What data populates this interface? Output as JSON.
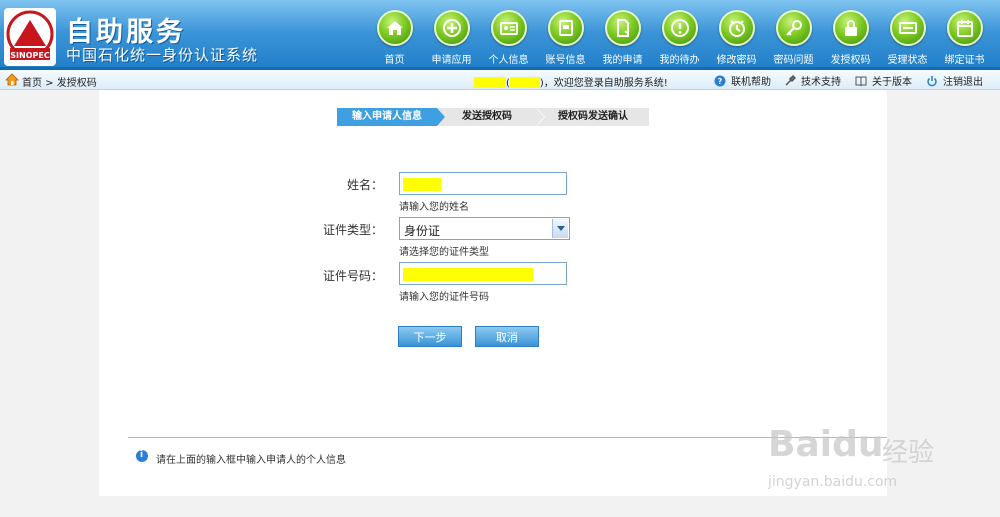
{
  "header": {
    "brand_title": "自助服务",
    "brand_subtitle": "中国石化统一身份认证系统",
    "logo_text": "SINOPEC 中国石化",
    "nav": [
      {
        "label": "首页",
        "icon": "home-icon"
      },
      {
        "label": "申请应用",
        "icon": "plus-icon"
      },
      {
        "label": "个人信息",
        "icon": "id-card-icon"
      },
      {
        "label": "账号信息",
        "icon": "account-book-icon"
      },
      {
        "label": "我的申请",
        "icon": "document-icon"
      },
      {
        "label": "我的待办",
        "icon": "exclamation-icon"
      },
      {
        "label": "修改密码",
        "icon": "clock-icon"
      },
      {
        "label": "密码问题",
        "icon": "key-icon"
      },
      {
        "label": "发授权码",
        "icon": "lock-icon"
      },
      {
        "label": "受理状态",
        "icon": "status-card-icon"
      },
      {
        "label": "绑定证书",
        "icon": "calendar-icon"
      }
    ]
  },
  "breadcrumb": {
    "text": "首页 > 发授权码",
    "welcome_suffix": "，欢迎您登录自助服务系统!",
    "open_paren": "(",
    "close_paren": ")",
    "links": [
      {
        "label": "联机帮助",
        "icon": "help-icon"
      },
      {
        "label": "技术支持",
        "icon": "tools-icon"
      },
      {
        "label": "关于版本",
        "icon": "book-icon"
      },
      {
        "label": "注销退出",
        "icon": "power-icon"
      }
    ]
  },
  "steps": [
    "输入申请人信息",
    "发送授权码",
    "授权码发送确认"
  ],
  "form": {
    "name_label": "姓名：",
    "name_hint": "请输入您的姓名",
    "id_type_label": "证件类型：",
    "id_type_value": "身份证",
    "id_type_hint": "请选择您的证件类型",
    "id_number_label": "证件号码：",
    "id_number_hint": "请输入您的证件号码"
  },
  "buttons": {
    "next": "下一步",
    "cancel": "取消"
  },
  "info": "请在上面的输入框中输入申请人的个人信息",
  "watermark": {
    "brand": "Bai",
    "brand2": "du",
    "cn": "经验",
    "url": "jingyan.baidu.com"
  },
  "colors": {
    "header_blue": "#2f8ad2",
    "nav_green": "#7fcb24",
    "active_step": "#3ea0e0",
    "redaction": "#ffff00"
  }
}
